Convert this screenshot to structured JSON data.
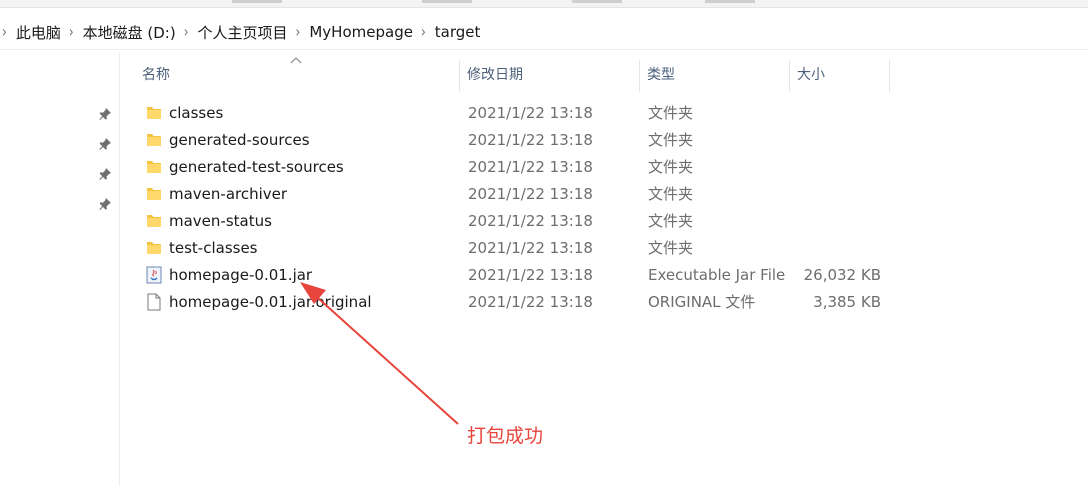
{
  "breadcrumb": {
    "items": [
      "此电脑",
      "本地磁盘 (D:)",
      "个人主页项目",
      "MyHomepage",
      "target"
    ]
  },
  "nav_pane": {
    "pins": [
      "pin-icon",
      "pin-icon",
      "pin-icon",
      "pin-icon"
    ]
  },
  "columns": {
    "name": "名称",
    "date": "修改日期",
    "type": "类型",
    "size": "大小",
    "sorted_by": "name"
  },
  "files": [
    {
      "name": "classes",
      "date": "2021/1/22 13:18",
      "type": "文件夹",
      "size": "",
      "icon": "folder-icon"
    },
    {
      "name": "generated-sources",
      "date": "2021/1/22 13:18",
      "type": "文件夹",
      "size": "",
      "icon": "folder-icon"
    },
    {
      "name": "generated-test-sources",
      "date": "2021/1/22 13:18",
      "type": "文件夹",
      "size": "",
      "icon": "folder-icon"
    },
    {
      "name": "maven-archiver",
      "date": "2021/1/22 13:18",
      "type": "文件夹",
      "size": "",
      "icon": "folder-icon"
    },
    {
      "name": "maven-status",
      "date": "2021/1/22 13:18",
      "type": "文件夹",
      "size": "",
      "icon": "folder-icon"
    },
    {
      "name": "test-classes",
      "date": "2021/1/22 13:18",
      "type": "文件夹",
      "size": "",
      "icon": "folder-icon"
    },
    {
      "name": "homepage-0.01.jar",
      "date": "2021/1/22 13:18",
      "type": "Executable Jar File",
      "size": "26,032 KB",
      "icon": "jar-file-icon"
    },
    {
      "name": "homepage-0.01.jar.original",
      "date": "2021/1/22 13:18",
      "type": "ORIGINAL 文件",
      "size": "3,385 KB",
      "icon": "file-icon"
    }
  ],
  "annotation": {
    "text": "打包成功",
    "color": "#e8453c"
  },
  "colors": {
    "folder": "#f4c33f",
    "header_text": "#4c607a",
    "muted_text": "#6d6d6d"
  }
}
